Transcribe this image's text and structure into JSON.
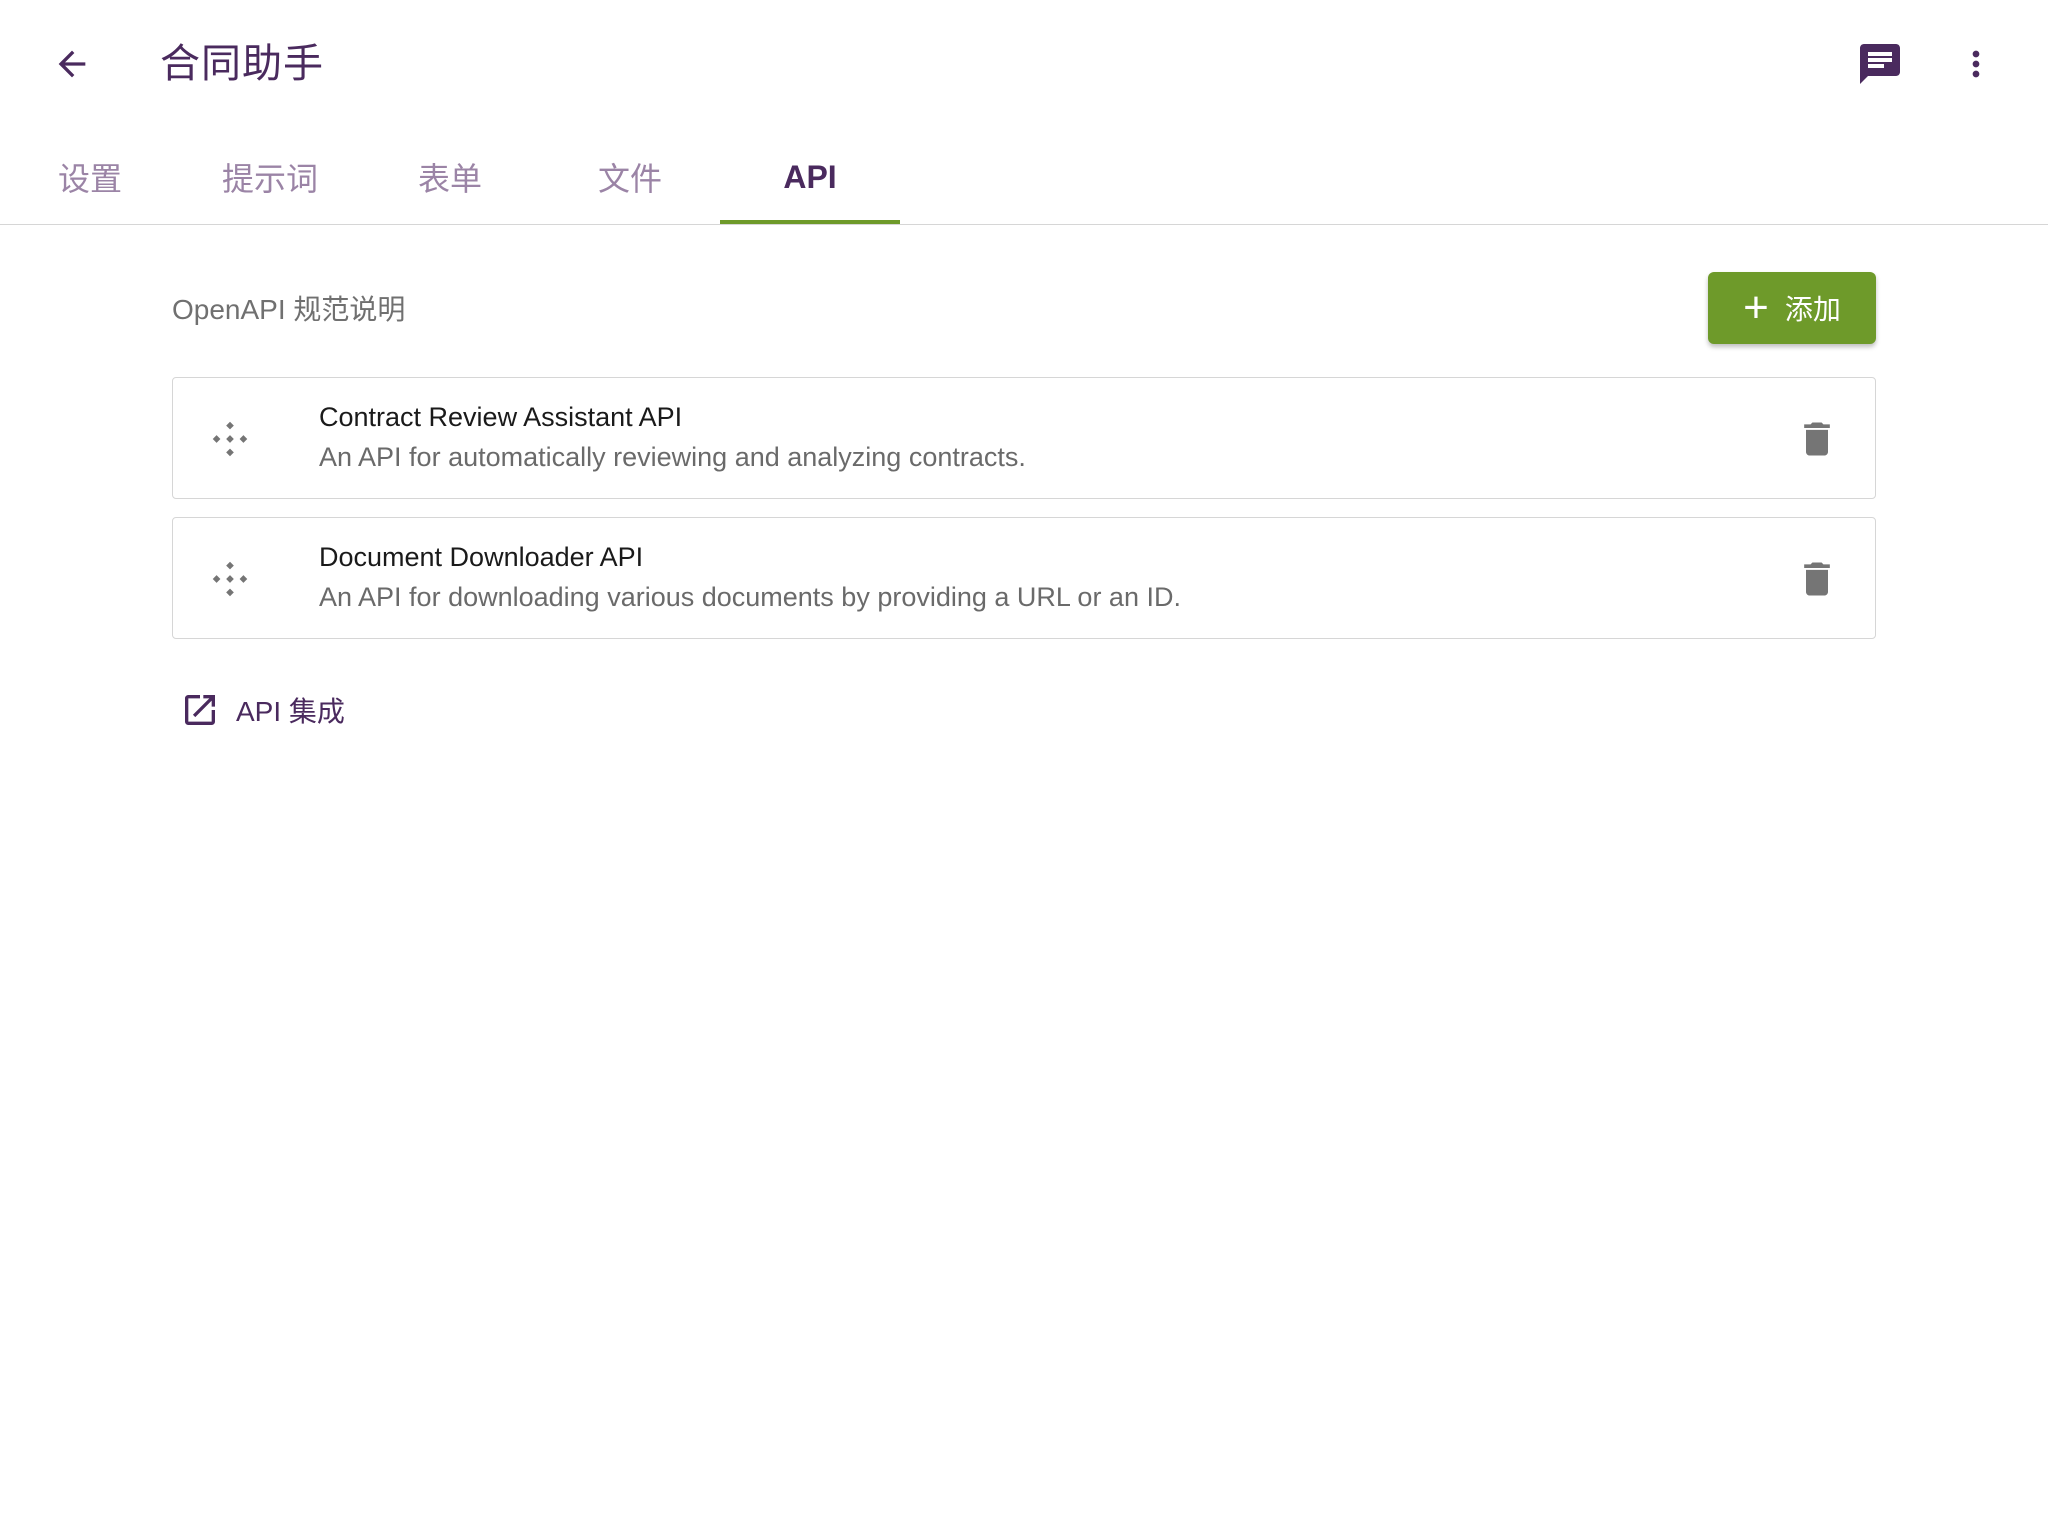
{
  "header": {
    "title": "合同助手",
    "icons": {
      "back": "arrow-left-icon",
      "chat": "chat-icon",
      "more": "more-vert-icon"
    }
  },
  "tabs": [
    {
      "label": "设置",
      "active": false
    },
    {
      "label": "提示词",
      "active": false
    },
    {
      "label": "表单",
      "active": false
    },
    {
      "label": "文件",
      "active": false
    },
    {
      "label": "API",
      "active": true
    }
  ],
  "section": {
    "label": "OpenAPI 规范说明",
    "add_button": {
      "label": "添加",
      "icon": "plus-icon"
    }
  },
  "apis": [
    {
      "title": "Contract Review Assistant API",
      "description": "An API for automatically reviewing and analyzing contracts.",
      "icon": "api-icon",
      "delete_icon": "trash-icon"
    },
    {
      "title": "Document Downloader API",
      "description": "An API for downloading various documents by providing a URL or an ID.",
      "icon": "api-icon",
      "delete_icon": "trash-icon"
    }
  ],
  "integration_link": {
    "label": "API 集成",
    "icon": "open-in-new-icon"
  },
  "colors": {
    "primary": "#4a2a5e",
    "accent": "#6e9a2a",
    "tab_inactive": "#9b84a6",
    "icon_gray": "#757575"
  }
}
